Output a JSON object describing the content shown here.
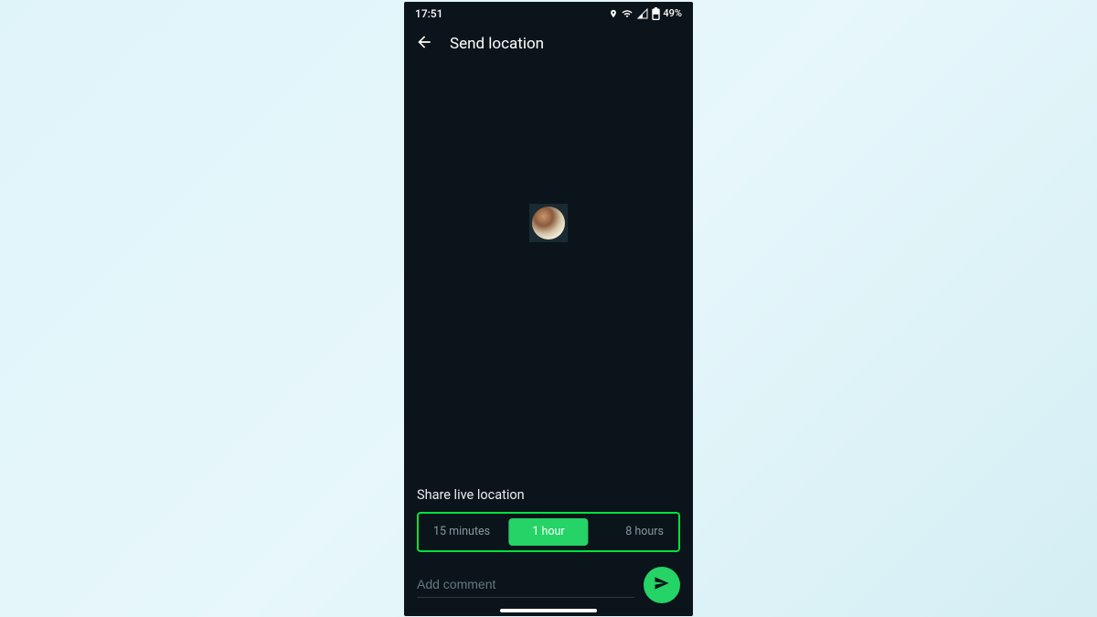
{
  "statusbar": {
    "time": "17:51",
    "battery": "49%"
  },
  "appbar": {
    "title": "Send location"
  },
  "section": {
    "title": "Share live location"
  },
  "durations": {
    "opt1": "15 minutes",
    "opt2": "1 hour",
    "opt3": "8 hours",
    "selected": "1 hour"
  },
  "comment": {
    "placeholder": "Add comment"
  }
}
